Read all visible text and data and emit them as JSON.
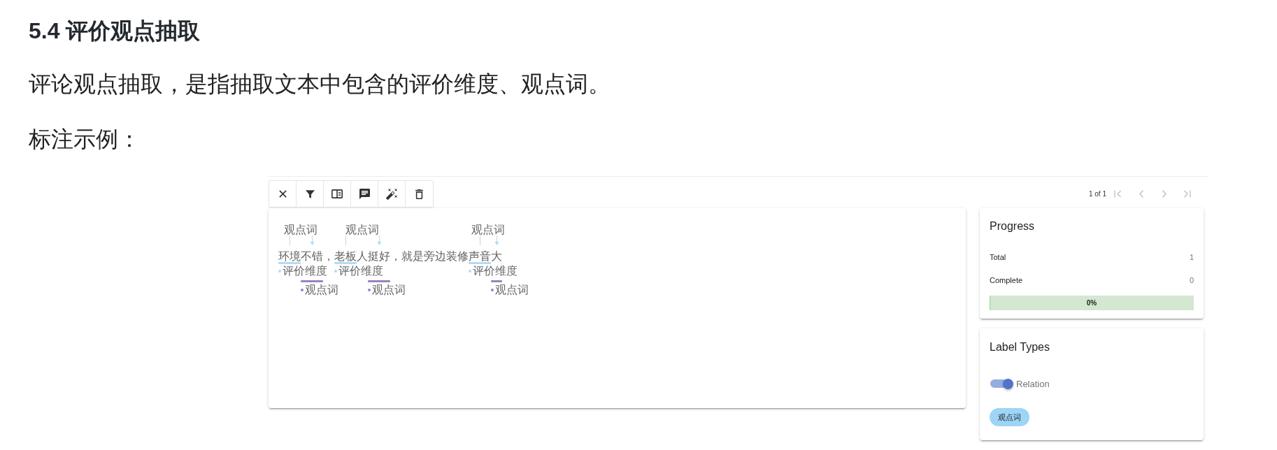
{
  "heading": "5.4 评价观点抽取",
  "paragraphs": [
    "评论观点抽取，是指抽取文本中包含的评价维度、观点词。",
    "标注示例："
  ],
  "annotator": {
    "toolbar": [
      {
        "kind": "close"
      },
      {
        "kind": "filter"
      },
      {
        "kind": "panel"
      },
      {
        "kind": "comment"
      },
      {
        "kind": "auto_label"
      },
      {
        "kind": "delete"
      }
    ],
    "pagination": {
      "text": "1 of 1",
      "buttons": [
        {
          "kind": "first",
          "disabled": true
        },
        {
          "kind": "previous",
          "disabled": true
        },
        {
          "kind": "next",
          "disabled": true
        },
        {
          "kind": "last",
          "disabled": true
        }
      ]
    },
    "document": [
      {
        "kind": "relation",
        "label": "观点词",
        "parts": [
          {
            "kind": "aspect",
            "text": "环境",
            "label": "评价维度",
            "color": "#b3dbf4"
          },
          {
            "kind": "opinion",
            "text": "不错",
            "label": "观点词",
            "color": "#9783c4"
          }
        ]
      },
      {
        "kind": "plain",
        "text": "，"
      },
      {
        "kind": "relation",
        "label": "观点词",
        "parts": [
          {
            "kind": "aspect",
            "text": "老板",
            "label": "评价维度",
            "color": "#b3dbf4"
          },
          {
            "kind": "plain",
            "text": "人"
          },
          {
            "kind": "opinion",
            "text": "挺好",
            "label": "观点词",
            "color": "#9783c4"
          }
        ]
      },
      {
        "kind": "plain",
        "text": "，就是旁边装修"
      },
      {
        "kind": "relation",
        "label": "观点词",
        "parts": [
          {
            "kind": "aspect",
            "text": "声音",
            "label": "评价维度",
            "color": "#b3dbf4"
          },
          {
            "kind": "opinion",
            "text": "大",
            "label": "观点词",
            "color": "#9783c4"
          }
        ]
      }
    ],
    "progress": {
      "title": "Progress",
      "rows": [
        {
          "label": "Total",
          "value": "1"
        },
        {
          "label": "Complete",
          "value": "0"
        }
      ],
      "bar": {
        "level": 0,
        "text": "0%"
      }
    },
    "label_types": {
      "title": "Label Types",
      "toggle": {
        "label": "Relation",
        "on": true
      },
      "chips": [
        {
          "text": "观点词",
          "color": "#9dd5f6"
        }
      ]
    }
  }
}
